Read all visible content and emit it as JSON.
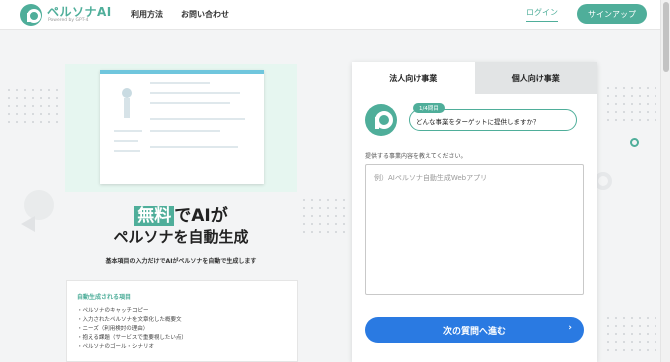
{
  "header": {
    "logo_name": "ペルソナAI",
    "logo_sub": "Powered by GPT-4",
    "nav": [
      "利用方法",
      "お問い合わせ"
    ],
    "login": "ログイン",
    "signup": "サインアップ"
  },
  "hero": {
    "title_highlight": "無料",
    "title_rest": "でAIが",
    "title_line2": "ペルソナを自動生成",
    "description": "基本項目の入力だけでAIがペルソナを自動で生成します"
  },
  "features": {
    "title": "自動生成される項目",
    "items": [
      "・ペルソナのキャッチコピー",
      "・入力されたペルソナを文章化した概要文",
      "・ニーズ（利用検討の理由）",
      "・抱える課題（サービスで重要視したい点）",
      "・ペルソナのゴール・シナリオ"
    ]
  },
  "form": {
    "tabs": [
      "法人向け事業",
      "個人向け事業"
    ],
    "step": "1/4問目",
    "question": "どんな事業をターゲットに提供しますか？",
    "field_label": "提供する事業内容を教えてください。",
    "placeholder": "例）AIペルソナ自動生成Webアプリ",
    "next": "次の質問へ進む",
    "next_chevron": "›"
  },
  "colors": {
    "brand": "#4fae9a",
    "primary_button": "#2a7ae2"
  }
}
